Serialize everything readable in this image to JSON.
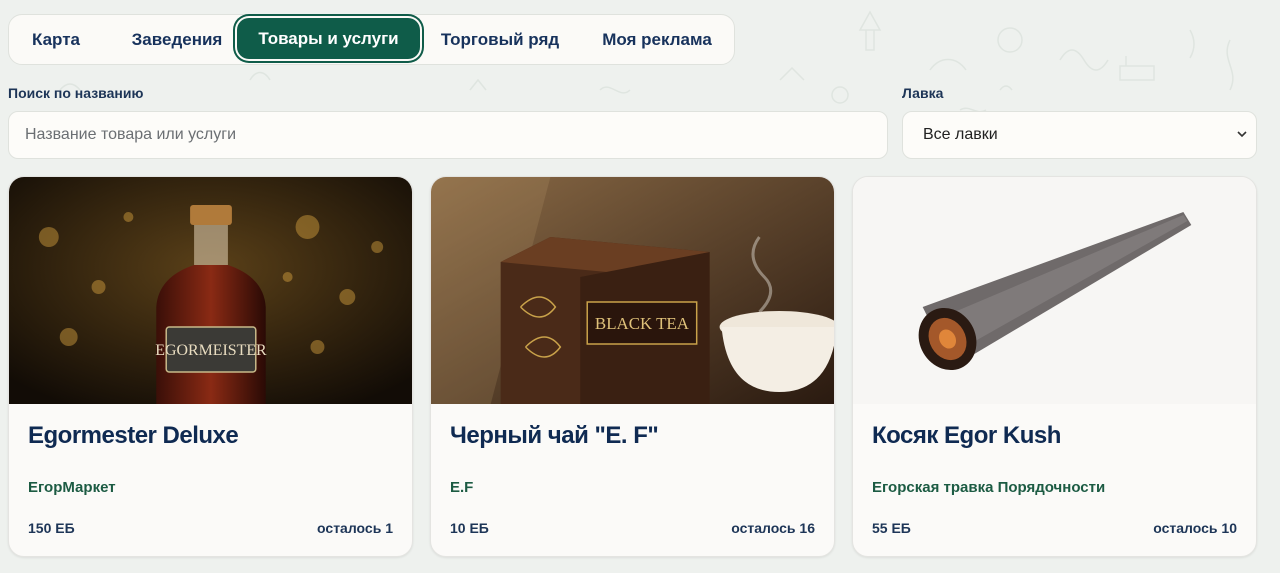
{
  "tabs": [
    {
      "label": "Карта"
    },
    {
      "label": "Заведения"
    },
    {
      "label": "Товары и услуги"
    },
    {
      "label": "Торговый ряд"
    },
    {
      "label": "Моя реклама"
    }
  ],
  "filters": {
    "search_label": "Поиск по названию",
    "search_placeholder": "Название товара или услуги",
    "shop_label": "Лавка",
    "shop_selected": "Все лавки"
  },
  "products": [
    {
      "title": "Egormester Deluxe",
      "shop": "ЕгорМаркет",
      "price": "150 ЕБ",
      "stock": "осталось 1",
      "image_text": "EGORMEISTER"
    },
    {
      "title": "Черный чай \"Е. F\"",
      "shop": "E.F",
      "price": "10 ЕБ",
      "stock": "осталось 16",
      "image_text": "BLACK TEA"
    },
    {
      "title": "Косяк Egor Kush",
      "shop": "Егорская травка Порядочности",
      "price": "55 ЕБ",
      "stock": "осталось 10"
    }
  ],
  "colors": {
    "accent": "#0f5c49",
    "title": "#0f2a52",
    "shop_text": "#1c5b43",
    "background": "#eef1ee"
  }
}
